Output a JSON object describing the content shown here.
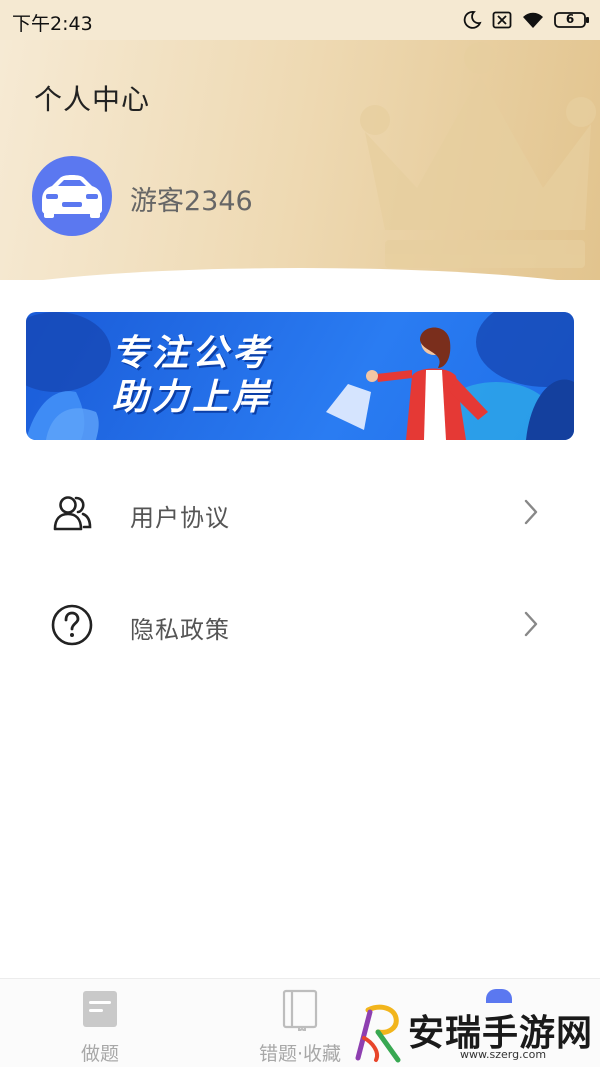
{
  "status_bar": {
    "time": "下午2:43",
    "battery_level": "6",
    "icons": [
      "moon-icon",
      "no-sim-icon",
      "wifi-icon",
      "battery-icon"
    ]
  },
  "header": {
    "title": "个人中心",
    "username": "游客2346",
    "avatar_icon": "car-icon"
  },
  "banner": {
    "line1": "专注公考",
    "line2": "助力上岸"
  },
  "menu": [
    {
      "label": "用户协议",
      "icon": "users-icon"
    },
    {
      "label": "隐私政策",
      "icon": "question-circle-icon"
    }
  ],
  "bottom_nav": [
    {
      "label": "做题",
      "icon": "document-icon"
    },
    {
      "label": "错题·收藏",
      "icon": "notebook-icon"
    }
  ],
  "watermark": {
    "text": "安瑞手游网",
    "url": "www.szerg.com"
  },
  "colors": {
    "accent": "#5b78f0",
    "banner_blue": "#1f6ee8",
    "header_gold": "#e2c48e"
  }
}
